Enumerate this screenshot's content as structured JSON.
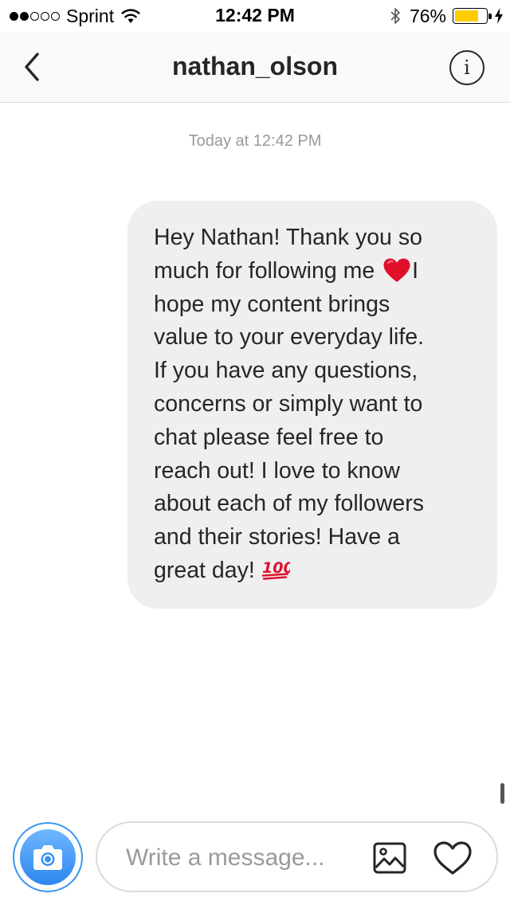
{
  "status_bar": {
    "signal_dots_filled": 2,
    "signal_dots_total": 5,
    "carrier": "Sprint",
    "time": "12:42 PM",
    "battery": "76%",
    "battery_level": 0.76,
    "battery_color": "#ffcc00"
  },
  "header": {
    "title": "nathan_olson",
    "back_icon": "chevron-left-icon",
    "info_icon": "info-circle-icon",
    "info_glyph": "i"
  },
  "conversation": {
    "timestamp": "Today at 12:42 PM",
    "messages": [
      {
        "text_before_heart": "Hey Nathan! Thank you so\nmuch for following me",
        "heart_emoji": "red-heart-emoji",
        "text_after_heart": "I\nhope my content brings\nvalue to your everyday life.\nIf you have any questions,\nconcerns or simply want to\nchat please feel free to\nreach out! I love to know\nabout each of my followers\nand their stories! Have a\ngreat day!",
        "end_emoji": "hundred-points-emoji",
        "end_emoji_text": "100"
      }
    ]
  },
  "composer": {
    "placeholder": "Write a message...",
    "camera_icon": "camera-icon",
    "gallery_icon": "image-gallery-icon",
    "like_icon": "heart-outline-icon",
    "accent_color": "#3897f0"
  }
}
